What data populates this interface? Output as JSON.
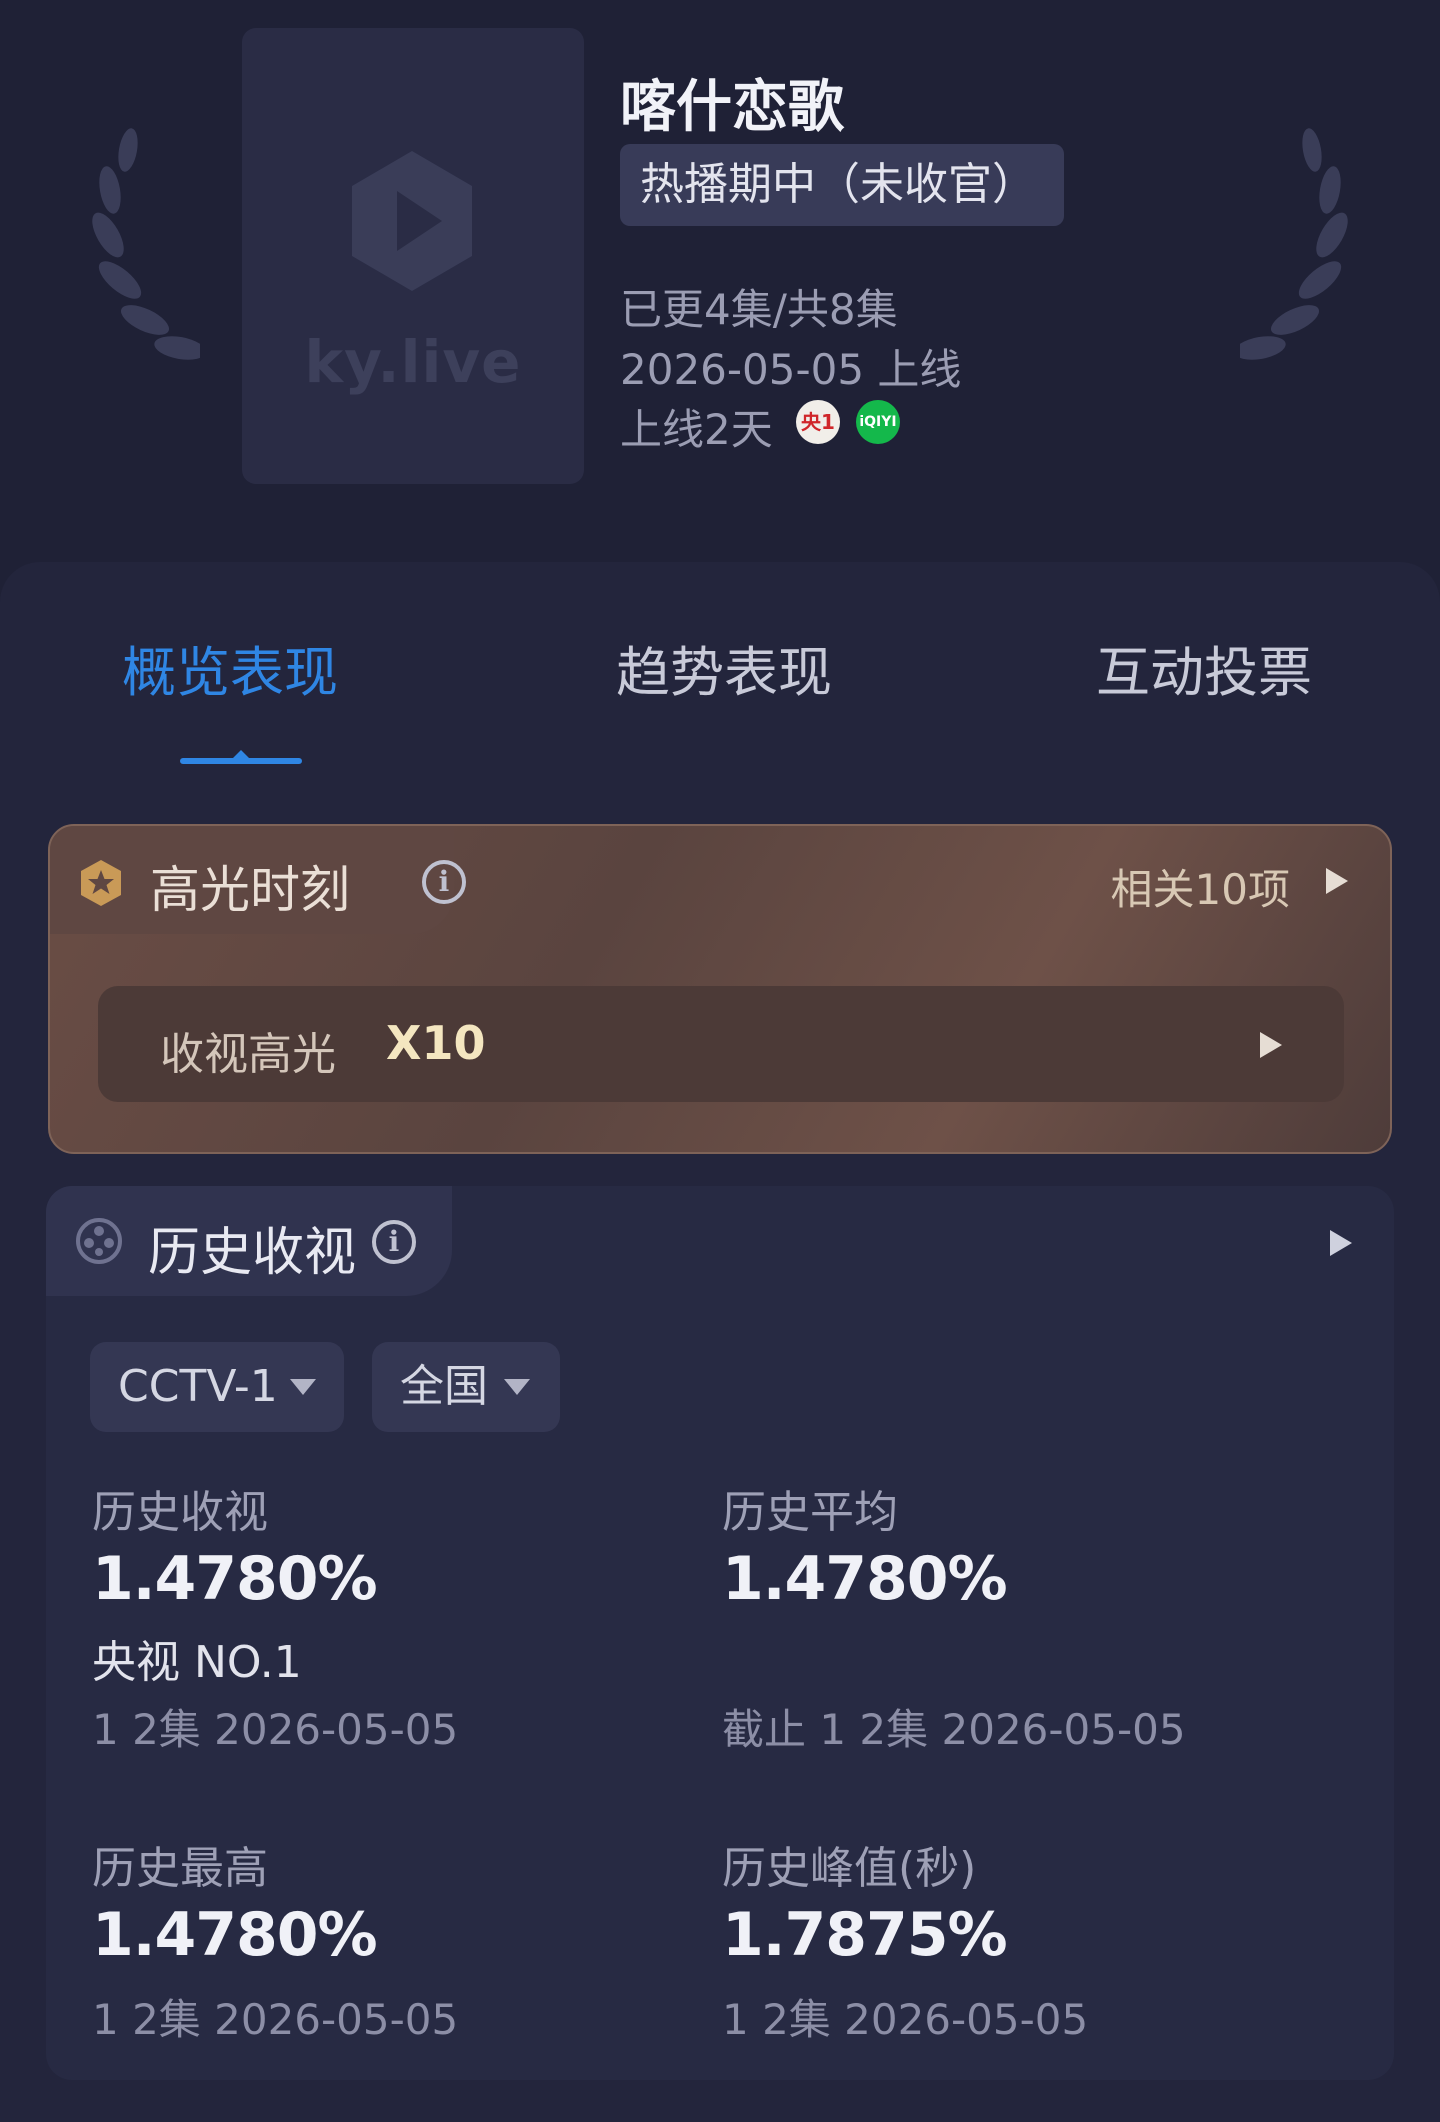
{
  "header": {
    "poster_brand": "ky.live",
    "title": "喀什恋歌",
    "status": "热播期中（未收官）",
    "episodes": "已更4集/共8集",
    "release": "2026-05-05 上线",
    "online_days": "上线2天",
    "channels": [
      {
        "name": "cctv1-icon",
        "label": "央1",
        "color": "#d0262a"
      },
      {
        "name": "iqiyi-icon",
        "label": "iQIYI",
        "color": "#14b84b"
      }
    ]
  },
  "tabs": [
    {
      "label": "概览表现",
      "active": true
    },
    {
      "label": "趋势表现",
      "active": false
    },
    {
      "label": "互动投票",
      "active": false
    }
  ],
  "highlight": {
    "title": "高光时刻",
    "related": "相关10项",
    "row_label": "收视高光",
    "row_value": "X10"
  },
  "history": {
    "title": "历史收视",
    "filters": {
      "channel": "CCTV-1",
      "region": "全国"
    },
    "stats": {
      "history_rating": {
        "label": "历史收视",
        "value": "1.4780%",
        "rank": "央视 NO.1",
        "sub": "1 2集 2026-05-05"
      },
      "history_avg": {
        "label": "历史平均",
        "value": "1.4780%",
        "sub": "截止 1 2集 2026-05-05"
      },
      "history_max": {
        "label": "历史最高",
        "value": "1.4780%",
        "sub": "1 2集 2026-05-05"
      },
      "history_peak": {
        "label": "历史峰值(秒)",
        "value": "1.7875%",
        "sub": "1 2集 2026-05-05"
      }
    }
  },
  "colors": {
    "background": "#1f2136",
    "accent": "#2f86e4",
    "highlight_gold": "#f4e6c0"
  }
}
